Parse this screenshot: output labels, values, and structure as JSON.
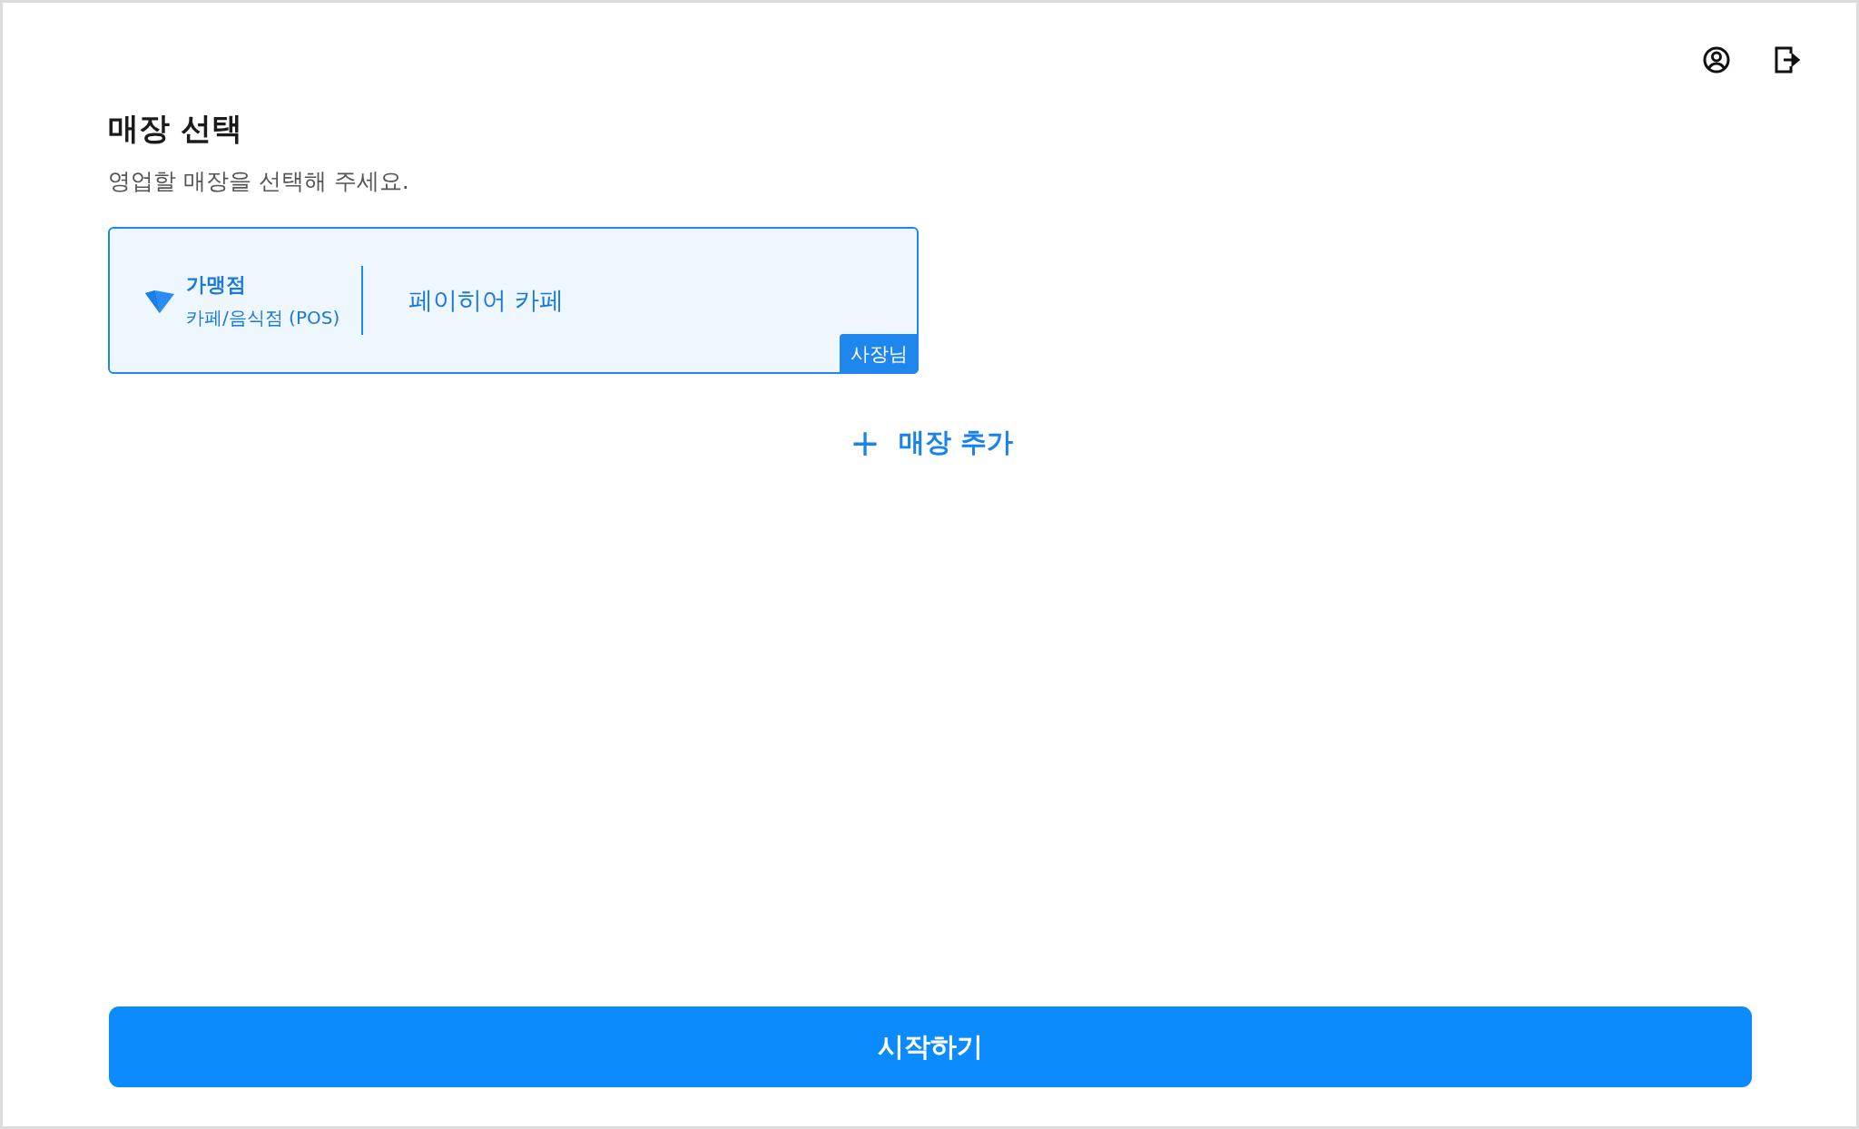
{
  "header": {
    "title": "매장 선택",
    "subtitle": "영업할 매장을 선택해 주세요."
  },
  "stores": [
    {
      "type": "가맹점",
      "category": "카페/음식점 (POS)",
      "name": "페이히어 카페",
      "role": "사장님",
      "selected": true
    }
  ],
  "add_store": {
    "icon": "+",
    "label": "매장 추가"
  },
  "start_button": {
    "label": "시작하기"
  }
}
